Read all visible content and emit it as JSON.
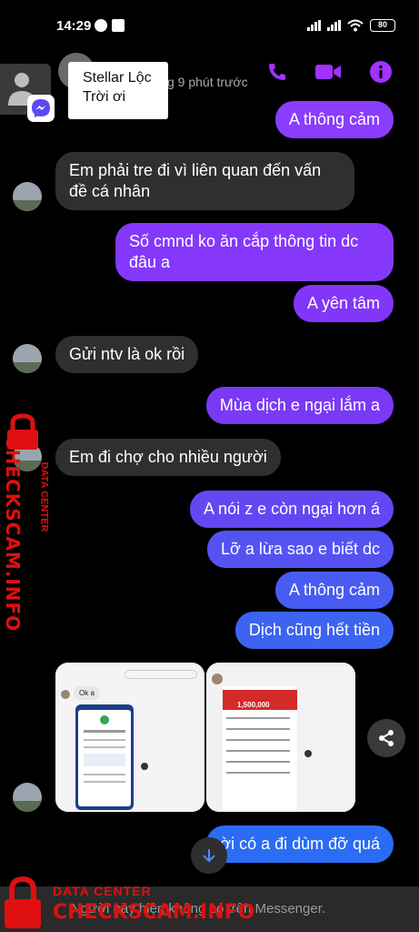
{
  "status_bar": {
    "time": "14:29",
    "battery": "80"
  },
  "header": {
    "active_status": "g 9 phút trước"
  },
  "chathead_tooltip": {
    "name": "Stellar Lộc",
    "message": "Trời ơi"
  },
  "messages": [
    {
      "side": "out",
      "text": "A thông cảm"
    },
    {
      "side": "in",
      "text": "Em phải tre đi vì liên quan đến vấn đề cá nhân"
    },
    {
      "side": "out",
      "text": "Số cmnd ko ăn cắp thông tin dc đâu a"
    },
    {
      "side": "out",
      "text": "A yên tâm"
    },
    {
      "side": "in",
      "text": "Gửi ntv là ok rồi"
    },
    {
      "side": "out",
      "text": "Mùa dịch e ngại lắm a"
    },
    {
      "side": "in",
      "text": "Em đi chợ cho nhiều người"
    },
    {
      "side": "out",
      "text": "A nói z e còn ngại hơn á"
    },
    {
      "side": "out",
      "text": "Lỡ a lừa sao e biết dc"
    },
    {
      "side": "out",
      "text": "A thông cảm"
    },
    {
      "side": "out",
      "text": "Dịch cũng hết tiền"
    },
    {
      "side": "out",
      "text": "ời có a đi dùm đỡ quá"
    }
  ],
  "image_preview": {
    "reply_text": "Ok a",
    "amount": "1,500,000"
  },
  "bottom_bar": {
    "notice": "Người này hiện không có trên Messenger."
  },
  "watermark": {
    "vertical": "CHECKSCAM.INFO",
    "vertical_small": "DATA CENTER",
    "bottom_title": "DATA CENTER",
    "bottom_brand": "CHECKSCAM.INFO"
  },
  "colors": {
    "accent": "#a033ff",
    "bubble_top": "#8a3cff",
    "bubble_bottom": "#2a6df5",
    "incoming": "#2f2f2f",
    "watermark": "#e01010"
  }
}
